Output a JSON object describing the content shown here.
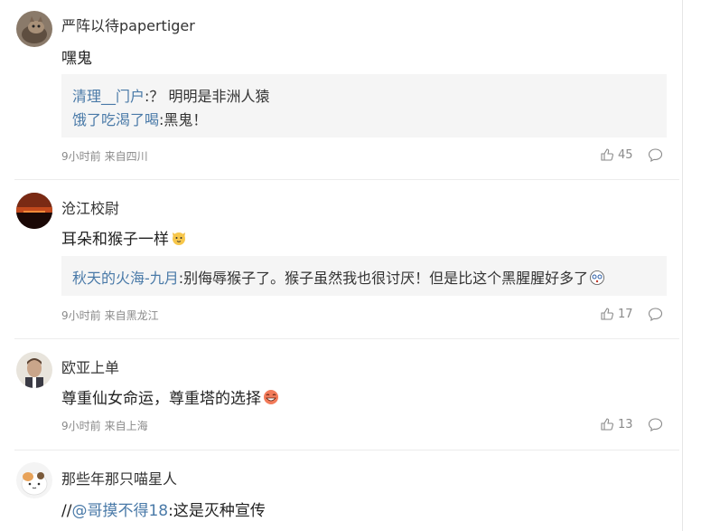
{
  "comments": [
    {
      "user": "严阵以待papertiger",
      "text": "嘿鬼",
      "replies": [
        {
          "who": "清理__门户",
          "sep": ":",
          "text": "？ 明明是非洲人猿"
        },
        {
          "who": "饿了吃渴了喝",
          "sep": ":",
          "text": "黑鬼！"
        }
      ],
      "time": "9小时前",
      "location": "来自四川",
      "likes": "45",
      "avatar_icon": "cat-photo-avatar"
    },
    {
      "user": "沧江校尉",
      "text": "耳朵和猴子一样",
      "emoji": "cat-face-emoji",
      "replies": [
        {
          "who": "秋天的火海-九月",
          "sep": ":",
          "text": "别侮辱猴子了。猴子虽然我也很讨厌！但是比这个黑腥腥好多了"
        }
      ],
      "time": "9小时前",
      "location": "来自黑龙江",
      "likes": "17",
      "avatar_icon": "sunset-photo-avatar"
    },
    {
      "user": "欧亚上单",
      "text": "尊重仙女命运，尊重塔的选择",
      "emoji": "laughing-emoji",
      "time": "9小时前",
      "location": "来自上海",
      "likes": "13",
      "avatar_icon": "portrait-avatar"
    },
    {
      "user": "那些年那只喵星人",
      "prefix": "//",
      "mention": "@哥摸不得18",
      "sep": ":",
      "text": "这是灭种宣传",
      "avatar_icon": "cartoon-cat-avatar"
    }
  ],
  "icons": {
    "like": "thumb-up-icon",
    "reply": "comment-bubble-icon"
  },
  "colors": {
    "link": "#4a7aa8",
    "reply_bg": "#f5f5f5",
    "meta": "#8a8a8a"
  }
}
